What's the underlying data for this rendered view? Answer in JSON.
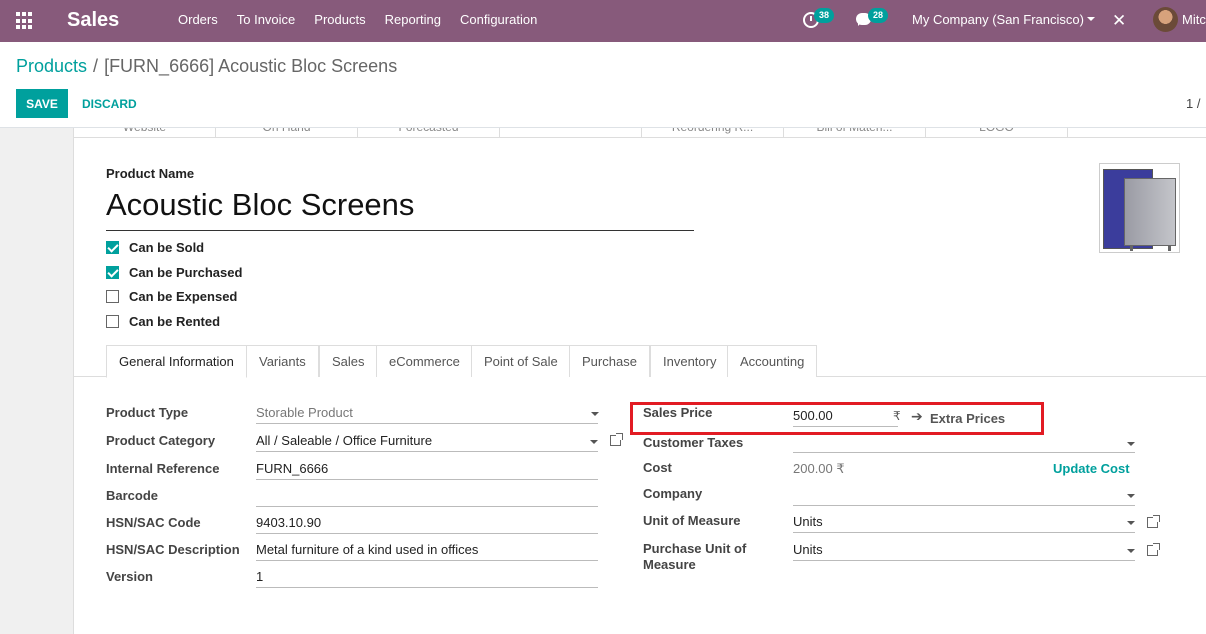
{
  "navbar": {
    "app_name": "Sales",
    "menu": [
      "Orders",
      "To Invoice",
      "Products",
      "Reporting",
      "Configuration"
    ],
    "activity_count": "38",
    "message_count": "28",
    "company": "My Company (San Francisco)",
    "user": "Mitc",
    "color": "#875a7b"
  },
  "control_panel": {
    "breadcrumb_parent": "Products",
    "breadcrumb_separator": "/",
    "breadcrumb_current": "[FURN_6666] Acoustic Bloc Screens",
    "save_label": "SAVE",
    "discard_label": "DISCARD",
    "pager": "1 /"
  },
  "smart_buttons": [
    "Website",
    "On Hand",
    "Forecasted",
    "",
    "Reordering R...",
    "Bill of Materi...",
    "LOGO"
  ],
  "product": {
    "name_label": "Product Name",
    "name": "Acoustic Bloc Screens",
    "checks": [
      {
        "label": "Can be Sold",
        "checked": true
      },
      {
        "label": "Can be Purchased",
        "checked": true
      },
      {
        "label": "Can be Expensed",
        "checked": false
      },
      {
        "label": "Can be Rented",
        "checked": false
      }
    ]
  },
  "tabs": [
    "General Information",
    "Variants",
    "Sales",
    "eCommerce",
    "Point of Sale",
    "Purchase",
    "Inventory",
    "Accounting"
  ],
  "left_fields": {
    "product_type": {
      "label": "Product Type",
      "value": "Storable Product"
    },
    "product_category": {
      "label": "Product Category",
      "value": "All / Saleable / Office Furniture"
    },
    "internal_reference": {
      "label": "Internal Reference",
      "value": "FURN_6666"
    },
    "barcode": {
      "label": "Barcode",
      "value": ""
    },
    "hsn_code": {
      "label": "HSN/SAC Code",
      "value": "9403.10.90"
    },
    "hsn_description": {
      "label": "HSN/SAC Description",
      "value": "Metal furniture of a kind used in offices"
    },
    "version": {
      "label": "Version",
      "value": "1"
    }
  },
  "right_fields": {
    "sales_price": {
      "label": "Sales Price",
      "value": "500.00",
      "currency": "₹",
      "extra_prices": "Extra Prices"
    },
    "customer_taxes": {
      "label": "Customer Taxes",
      "value": ""
    },
    "cost": {
      "label": "Cost",
      "value": "200.00 ₹",
      "update_cost": "Update Cost"
    },
    "company": {
      "label": "Company",
      "value": ""
    },
    "uom": {
      "label": "Unit of Measure",
      "value": "Units"
    },
    "purchase_uom": {
      "label": "Purchase Unit of Measure",
      "value": "Units"
    }
  },
  "colors": {
    "accent": "#00a09d",
    "highlight": "#e21b23"
  }
}
